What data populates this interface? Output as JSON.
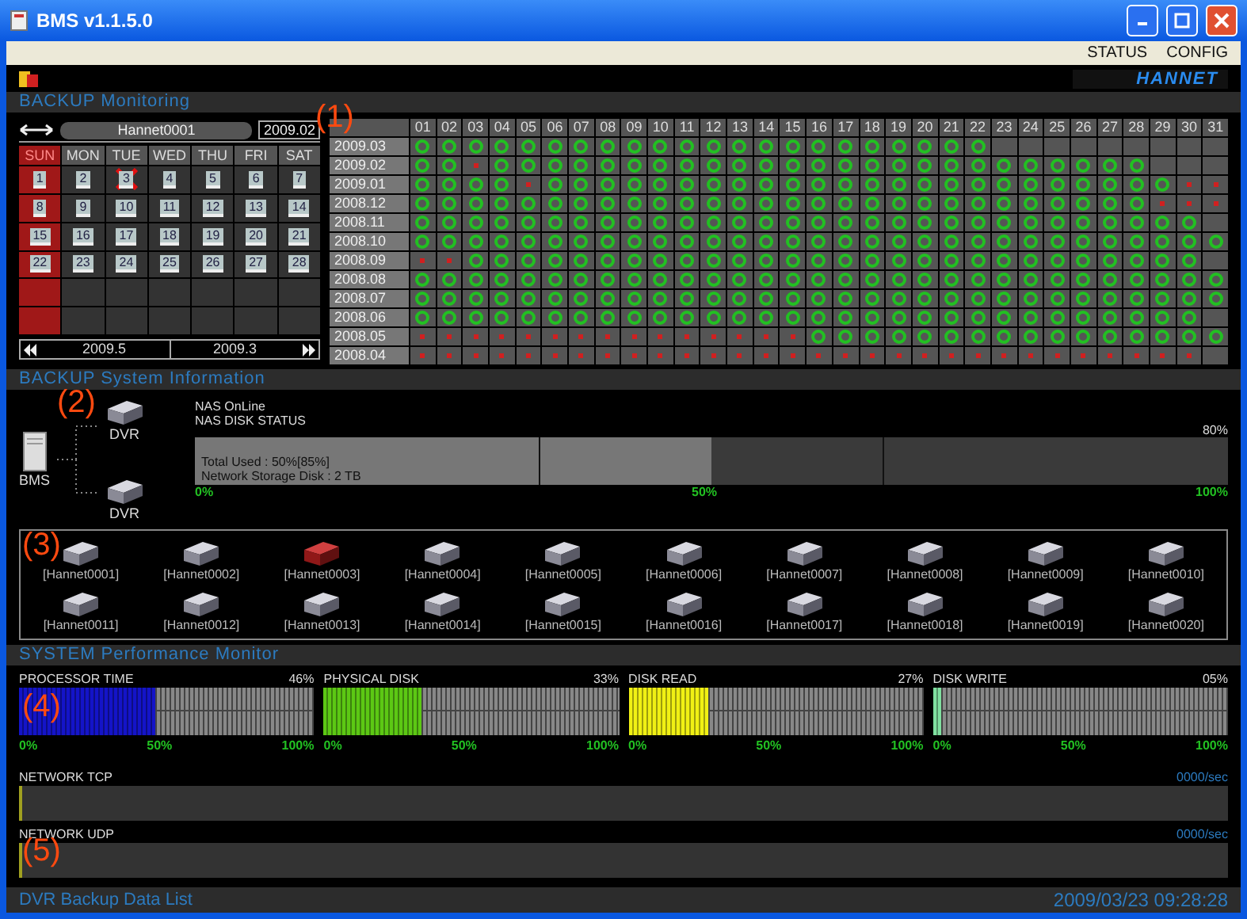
{
  "window": {
    "title": "BMS v1.1.5.0"
  },
  "menu": [
    "STATUS",
    "CONFIG"
  ],
  "logo": "HANNET",
  "callouts": [
    "(1)",
    "(2)",
    "(3)",
    "(4)",
    "(5)"
  ],
  "backup_monitoring": {
    "title": "BACKUP Monitoring",
    "calendar": {
      "device": "Hannet0001",
      "month": "2009.02",
      "weekdays": [
        "SUN",
        "MON",
        "TUE",
        "WED",
        "THU",
        "FRI",
        "SAT"
      ],
      "days": [
        {
          "label": "1",
          "failed": false
        },
        {
          "label": "2",
          "failed": false
        },
        {
          "label": "3",
          "failed": true
        },
        {
          "label": "4",
          "failed": false
        },
        {
          "label": "5",
          "failed": false
        },
        {
          "label": "6",
          "failed": false
        },
        {
          "label": "7",
          "failed": false
        },
        {
          "label": "8",
          "failed": false
        },
        {
          "label": "9",
          "failed": false
        },
        {
          "label": "10",
          "failed": false
        },
        {
          "label": "11",
          "failed": false
        },
        {
          "label": "12",
          "failed": false
        },
        {
          "label": "13",
          "failed": false
        },
        {
          "label": "14",
          "failed": false
        },
        {
          "label": "15",
          "failed": false
        },
        {
          "label": "16",
          "failed": false
        },
        {
          "label": "17",
          "failed": false
        },
        {
          "label": "18",
          "failed": false
        },
        {
          "label": "19",
          "failed": false
        },
        {
          "label": "20",
          "failed": false
        },
        {
          "label": "21",
          "failed": false
        },
        {
          "label": "22",
          "failed": false
        },
        {
          "label": "23",
          "failed": false
        },
        {
          "label": "24",
          "failed": false
        },
        {
          "label": "25",
          "failed": false
        },
        {
          "label": "26",
          "failed": false
        },
        {
          "label": "27",
          "failed": false
        },
        {
          "label": "28",
          "failed": false
        }
      ],
      "prev_month": "2009.5",
      "next_month": "2009.3"
    },
    "grid": {
      "columns": [
        "01",
        "02",
        "03",
        "04",
        "05",
        "06",
        "07",
        "08",
        "09",
        "10",
        "11",
        "12",
        "13",
        "14",
        "15",
        "16",
        "17",
        "18",
        "19",
        "20",
        "21",
        "22",
        "23",
        "24",
        "25",
        "26",
        "27",
        "28",
        "29",
        "30",
        "31"
      ],
      "rows": [
        {
          "month": "2009.03",
          "cells": [
            {
              "kind": "ok"
            },
            {
              "kind": "ok"
            },
            {
              "kind": "ok"
            },
            {
              "kind": "ok"
            },
            {
              "kind": "ok"
            },
            {
              "kind": "ok"
            },
            {
              "kind": "ok"
            },
            {
              "kind": "ok"
            },
            {
              "kind": "ok"
            },
            {
              "kind": "ok"
            },
            {
              "kind": "ok"
            },
            {
              "kind": "ok"
            },
            {
              "kind": "ok"
            },
            {
              "kind": "ok"
            },
            {
              "kind": "ok"
            },
            {
              "kind": "ok"
            },
            {
              "kind": "ok"
            },
            {
              "kind": "ok"
            },
            {
              "kind": "ok"
            },
            {
              "kind": "ok"
            },
            {
              "kind": "ok"
            },
            {
              "kind": "ok"
            },
            {
              "kind": "none"
            },
            {
              "kind": "none"
            },
            {
              "kind": "none"
            },
            {
              "kind": "none"
            },
            {
              "kind": "none"
            },
            {
              "kind": "none"
            },
            {
              "kind": "none"
            },
            {
              "kind": "none"
            },
            {
              "kind": "none"
            }
          ]
        },
        {
          "month": "2009.02",
          "cells": [
            {
              "kind": "ok"
            },
            {
              "kind": "ok"
            },
            {
              "kind": "fail"
            },
            {
              "kind": "ok"
            },
            {
              "kind": "ok"
            },
            {
              "kind": "ok"
            },
            {
              "kind": "ok"
            },
            {
              "kind": "ok"
            },
            {
              "kind": "ok"
            },
            {
              "kind": "ok"
            },
            {
              "kind": "ok"
            },
            {
              "kind": "ok"
            },
            {
              "kind": "ok"
            },
            {
              "kind": "ok"
            },
            {
              "kind": "ok"
            },
            {
              "kind": "ok"
            },
            {
              "kind": "ok"
            },
            {
              "kind": "ok"
            },
            {
              "kind": "ok"
            },
            {
              "kind": "ok"
            },
            {
              "kind": "ok"
            },
            {
              "kind": "ok"
            },
            {
              "kind": "ok"
            },
            {
              "kind": "ok"
            },
            {
              "kind": "ok"
            },
            {
              "kind": "ok"
            },
            {
              "kind": "ok"
            },
            {
              "kind": "ok"
            },
            {
              "kind": "none"
            },
            {
              "kind": "none"
            },
            {
              "kind": "none"
            }
          ]
        },
        {
          "month": "2009.01",
          "cells": [
            {
              "kind": "ok"
            },
            {
              "kind": "ok"
            },
            {
              "kind": "ok"
            },
            {
              "kind": "ok"
            },
            {
              "kind": "fail"
            },
            {
              "kind": "ok"
            },
            {
              "kind": "ok"
            },
            {
              "kind": "ok"
            },
            {
              "kind": "ok"
            },
            {
              "kind": "ok"
            },
            {
              "kind": "ok"
            },
            {
              "kind": "ok"
            },
            {
              "kind": "ok"
            },
            {
              "kind": "ok"
            },
            {
              "kind": "ok"
            },
            {
              "kind": "ok"
            },
            {
              "kind": "ok"
            },
            {
              "kind": "ok"
            },
            {
              "kind": "ok"
            },
            {
              "kind": "ok"
            },
            {
              "kind": "ok"
            },
            {
              "kind": "ok"
            },
            {
              "kind": "ok"
            },
            {
              "kind": "ok"
            },
            {
              "kind": "ok"
            },
            {
              "kind": "ok"
            },
            {
              "kind": "ok"
            },
            {
              "kind": "ok"
            },
            {
              "kind": "ok"
            },
            {
              "kind": "fail"
            },
            {
              "kind": "fail"
            }
          ]
        },
        {
          "month": "2008.12",
          "cells": [
            {
              "kind": "ok"
            },
            {
              "kind": "ok"
            },
            {
              "kind": "ok"
            },
            {
              "kind": "ok"
            },
            {
              "kind": "ok"
            },
            {
              "kind": "ok"
            },
            {
              "kind": "ok"
            },
            {
              "kind": "ok"
            },
            {
              "kind": "ok"
            },
            {
              "kind": "ok"
            },
            {
              "kind": "ok"
            },
            {
              "kind": "ok"
            },
            {
              "kind": "ok"
            },
            {
              "kind": "ok"
            },
            {
              "kind": "ok"
            },
            {
              "kind": "ok"
            },
            {
              "kind": "ok"
            },
            {
              "kind": "ok"
            },
            {
              "kind": "ok"
            },
            {
              "kind": "ok"
            },
            {
              "kind": "ok"
            },
            {
              "kind": "ok"
            },
            {
              "kind": "ok"
            },
            {
              "kind": "ok"
            },
            {
              "kind": "ok"
            },
            {
              "kind": "ok"
            },
            {
              "kind": "ok"
            },
            {
              "kind": "ok"
            },
            {
              "kind": "fail"
            },
            {
              "kind": "fail"
            },
            {
              "kind": "fail"
            }
          ]
        },
        {
          "month": "2008.11",
          "cells": [
            {
              "kind": "ok"
            },
            {
              "kind": "ok"
            },
            {
              "kind": "ok"
            },
            {
              "kind": "ok"
            },
            {
              "kind": "ok"
            },
            {
              "kind": "ok"
            },
            {
              "kind": "ok"
            },
            {
              "kind": "ok"
            },
            {
              "kind": "ok"
            },
            {
              "kind": "ok"
            },
            {
              "kind": "ok"
            },
            {
              "kind": "ok"
            },
            {
              "kind": "ok"
            },
            {
              "kind": "ok"
            },
            {
              "kind": "ok"
            },
            {
              "kind": "ok"
            },
            {
              "kind": "ok"
            },
            {
              "kind": "ok"
            },
            {
              "kind": "ok"
            },
            {
              "kind": "ok"
            },
            {
              "kind": "ok"
            },
            {
              "kind": "ok"
            },
            {
              "kind": "ok"
            },
            {
              "kind": "ok"
            },
            {
              "kind": "ok"
            },
            {
              "kind": "ok"
            },
            {
              "kind": "ok"
            },
            {
              "kind": "ok"
            },
            {
              "kind": "ok"
            },
            {
              "kind": "ok"
            },
            {
              "kind": "none"
            }
          ]
        },
        {
          "month": "2008.10",
          "cells": [
            {
              "kind": "ok"
            },
            {
              "kind": "ok"
            },
            {
              "kind": "ok"
            },
            {
              "kind": "ok"
            },
            {
              "kind": "ok"
            },
            {
              "kind": "ok"
            },
            {
              "kind": "ok"
            },
            {
              "kind": "ok"
            },
            {
              "kind": "ok"
            },
            {
              "kind": "ok"
            },
            {
              "kind": "ok"
            },
            {
              "kind": "ok"
            },
            {
              "kind": "ok"
            },
            {
              "kind": "ok"
            },
            {
              "kind": "ok"
            },
            {
              "kind": "ok"
            },
            {
              "kind": "ok"
            },
            {
              "kind": "ok"
            },
            {
              "kind": "ok"
            },
            {
              "kind": "ok"
            },
            {
              "kind": "ok"
            },
            {
              "kind": "ok"
            },
            {
              "kind": "ok"
            },
            {
              "kind": "ok"
            },
            {
              "kind": "ok"
            },
            {
              "kind": "ok"
            },
            {
              "kind": "ok"
            },
            {
              "kind": "ok"
            },
            {
              "kind": "ok"
            },
            {
              "kind": "ok"
            },
            {
              "kind": "ok"
            }
          ]
        },
        {
          "month": "2008.09",
          "cells": [
            {
              "kind": "fail"
            },
            {
              "kind": "fail"
            },
            {
              "kind": "ok"
            },
            {
              "kind": "ok"
            },
            {
              "kind": "ok"
            },
            {
              "kind": "ok"
            },
            {
              "kind": "ok"
            },
            {
              "kind": "ok"
            },
            {
              "kind": "ok"
            },
            {
              "kind": "ok"
            },
            {
              "kind": "ok"
            },
            {
              "kind": "ok"
            },
            {
              "kind": "ok"
            },
            {
              "kind": "ok"
            },
            {
              "kind": "ok"
            },
            {
              "kind": "ok"
            },
            {
              "kind": "ok"
            },
            {
              "kind": "ok"
            },
            {
              "kind": "ok"
            },
            {
              "kind": "ok"
            },
            {
              "kind": "ok"
            },
            {
              "kind": "ok"
            },
            {
              "kind": "ok"
            },
            {
              "kind": "ok"
            },
            {
              "kind": "ok"
            },
            {
              "kind": "ok"
            },
            {
              "kind": "ok"
            },
            {
              "kind": "ok"
            },
            {
              "kind": "ok"
            },
            {
              "kind": "ok"
            },
            {
              "kind": "none"
            }
          ]
        },
        {
          "month": "2008.08",
          "cells": [
            {
              "kind": "ok"
            },
            {
              "kind": "ok"
            },
            {
              "kind": "ok"
            },
            {
              "kind": "ok"
            },
            {
              "kind": "ok"
            },
            {
              "kind": "ok"
            },
            {
              "kind": "ok"
            },
            {
              "kind": "ok"
            },
            {
              "kind": "ok"
            },
            {
              "kind": "ok"
            },
            {
              "kind": "ok"
            },
            {
              "kind": "ok"
            },
            {
              "kind": "ok"
            },
            {
              "kind": "ok"
            },
            {
              "kind": "ok"
            },
            {
              "kind": "ok"
            },
            {
              "kind": "ok"
            },
            {
              "kind": "ok"
            },
            {
              "kind": "ok"
            },
            {
              "kind": "ok"
            },
            {
              "kind": "ok"
            },
            {
              "kind": "ok"
            },
            {
              "kind": "ok"
            },
            {
              "kind": "ok"
            },
            {
              "kind": "ok"
            },
            {
              "kind": "ok"
            },
            {
              "kind": "ok"
            },
            {
              "kind": "ok"
            },
            {
              "kind": "ok"
            },
            {
              "kind": "ok"
            },
            {
              "kind": "ok"
            }
          ]
        },
        {
          "month": "2008.07",
          "cells": [
            {
              "kind": "ok"
            },
            {
              "kind": "ok"
            },
            {
              "kind": "ok"
            },
            {
              "kind": "ok"
            },
            {
              "kind": "ok"
            },
            {
              "kind": "ok"
            },
            {
              "kind": "ok"
            },
            {
              "kind": "ok"
            },
            {
              "kind": "ok"
            },
            {
              "kind": "ok"
            },
            {
              "kind": "ok"
            },
            {
              "kind": "ok"
            },
            {
              "kind": "ok"
            },
            {
              "kind": "ok"
            },
            {
              "kind": "ok"
            },
            {
              "kind": "ok"
            },
            {
              "kind": "ok"
            },
            {
              "kind": "ok"
            },
            {
              "kind": "ok"
            },
            {
              "kind": "ok"
            },
            {
              "kind": "ok"
            },
            {
              "kind": "ok"
            },
            {
              "kind": "ok"
            },
            {
              "kind": "ok"
            },
            {
              "kind": "ok"
            },
            {
              "kind": "ok"
            },
            {
              "kind": "ok"
            },
            {
              "kind": "ok"
            },
            {
              "kind": "ok"
            },
            {
              "kind": "ok"
            },
            {
              "kind": "ok"
            }
          ]
        },
        {
          "month": "2008.06",
          "cells": [
            {
              "kind": "ok"
            },
            {
              "kind": "ok"
            },
            {
              "kind": "ok"
            },
            {
              "kind": "ok"
            },
            {
              "kind": "ok"
            },
            {
              "kind": "ok"
            },
            {
              "kind": "ok"
            },
            {
              "kind": "ok"
            },
            {
              "kind": "ok"
            },
            {
              "kind": "ok"
            },
            {
              "kind": "ok"
            },
            {
              "kind": "ok"
            },
            {
              "kind": "ok"
            },
            {
              "kind": "ok"
            },
            {
              "kind": "ok"
            },
            {
              "kind": "ok"
            },
            {
              "kind": "ok"
            },
            {
              "kind": "ok"
            },
            {
              "kind": "ok"
            },
            {
              "kind": "ok"
            },
            {
              "kind": "ok"
            },
            {
              "kind": "ok"
            },
            {
              "kind": "ok"
            },
            {
              "kind": "ok"
            },
            {
              "kind": "ok"
            },
            {
              "kind": "ok"
            },
            {
              "kind": "ok"
            },
            {
              "kind": "ok"
            },
            {
              "kind": "ok"
            },
            {
              "kind": "ok"
            },
            {
              "kind": "none"
            }
          ]
        },
        {
          "month": "2008.05",
          "cells": [
            {
              "kind": "fail"
            },
            {
              "kind": "fail"
            },
            {
              "kind": "fail"
            },
            {
              "kind": "fail"
            },
            {
              "kind": "fail"
            },
            {
              "kind": "fail"
            },
            {
              "kind": "fail"
            },
            {
              "kind": "fail"
            },
            {
              "kind": "fail"
            },
            {
              "kind": "fail"
            },
            {
              "kind": "fail"
            },
            {
              "kind": "fail"
            },
            {
              "kind": "fail"
            },
            {
              "kind": "fail"
            },
            {
              "kind": "fail"
            },
            {
              "kind": "ok"
            },
            {
              "kind": "ok"
            },
            {
              "kind": "ok"
            },
            {
              "kind": "ok"
            },
            {
              "kind": "ok"
            },
            {
              "kind": "ok"
            },
            {
              "kind": "ok"
            },
            {
              "kind": "ok"
            },
            {
              "kind": "ok"
            },
            {
              "kind": "ok"
            },
            {
              "kind": "ok"
            },
            {
              "kind": "ok"
            },
            {
              "kind": "ok"
            },
            {
              "kind": "ok"
            },
            {
              "kind": "ok"
            },
            {
              "kind": "ok"
            }
          ]
        },
        {
          "month": "2008.04",
          "cells": [
            {
              "kind": "fail"
            },
            {
              "kind": "fail"
            },
            {
              "kind": "fail"
            },
            {
              "kind": "fail"
            },
            {
              "kind": "fail"
            },
            {
              "kind": "fail"
            },
            {
              "kind": "fail"
            },
            {
              "kind": "fail"
            },
            {
              "kind": "fail"
            },
            {
              "kind": "fail"
            },
            {
              "kind": "fail"
            },
            {
              "kind": "fail"
            },
            {
              "kind": "fail"
            },
            {
              "kind": "fail"
            },
            {
              "kind": "fail"
            },
            {
              "kind": "fail"
            },
            {
              "kind": "fail"
            },
            {
              "kind": "fail"
            },
            {
              "kind": "fail"
            },
            {
              "kind": "fail"
            },
            {
              "kind": "fail"
            },
            {
              "kind": "fail"
            },
            {
              "kind": "fail"
            },
            {
              "kind": "fail"
            },
            {
              "kind": "fail"
            },
            {
              "kind": "fail"
            },
            {
              "kind": "fail"
            },
            {
              "kind": "fail"
            },
            {
              "kind": "fail"
            },
            {
              "kind": "fail"
            },
            {
              "kind": "none"
            }
          ]
        }
      ]
    }
  },
  "system_info": {
    "title": "BACKUP System Information",
    "server_label": "BMS",
    "dvr_labels": [
      "DVR",
      "DVR"
    ],
    "nas_state": "NAS OnLine",
    "disk_title": "NAS DISK STATUS",
    "disk": {
      "reading": "80%",
      "level": 0.5,
      "total_used": "Total Used : 50%[85%]",
      "storage": "Network Storage Disk : 2 TB",
      "ticks": [
        "0%",
        "50%",
        "100%"
      ]
    }
  },
  "dvrs": [
    {
      "label": "[Hannet0001]",
      "error": false
    },
    {
      "label": "[Hannet0002]",
      "error": false
    },
    {
      "label": "[Hannet0003]",
      "error": true
    },
    {
      "label": "[Hannet0004]",
      "error": false
    },
    {
      "label": "[Hannet0005]",
      "error": false
    },
    {
      "label": "[Hannet0006]",
      "error": false
    },
    {
      "label": "[Hannet0007]",
      "error": false
    },
    {
      "label": "[Hannet0008]",
      "error": false
    },
    {
      "label": "[Hannet0009]",
      "error": false
    },
    {
      "label": "[Hannet0010]",
      "error": false
    },
    {
      "label": "[Hannet0011]",
      "error": false
    },
    {
      "label": "[Hannet0012]",
      "error": false
    },
    {
      "label": "[Hannet0013]",
      "error": false
    },
    {
      "label": "[Hannet0014]",
      "error": false
    },
    {
      "label": "[Hannet0015]",
      "error": false
    },
    {
      "label": "[Hannet0016]",
      "error": false
    },
    {
      "label": "[Hannet0017]",
      "error": false
    },
    {
      "label": "[Hannet0018]",
      "error": false
    },
    {
      "label": "[Hannet0019]",
      "error": false
    },
    {
      "label": "[Hannet0020]",
      "error": false
    }
  ],
  "performance": {
    "title": "SYSTEM Performance Monitor",
    "meters": [
      {
        "name": "PROCESSOR TIME",
        "reading": "46%",
        "level": 0.46,
        "color": "#1414c8",
        "ticks": [
          "0%",
          "50%",
          "100%"
        ]
      },
      {
        "name": "PHYSICAL DISK",
        "reading": "33%",
        "level": 0.33,
        "color": "#5cc814",
        "ticks": [
          "0%",
          "50%",
          "100%"
        ]
      },
      {
        "name": "DISK READ",
        "reading": "27%",
        "level": 0.27,
        "color": "#f0f014",
        "ticks": [
          "0%",
          "50%",
          "100%"
        ]
      },
      {
        "name": "DISK WRITE",
        "reading": "05%",
        "level": 0.03,
        "color": "#80e0a0",
        "ticks": [
          "0%",
          "50%",
          "100%"
        ]
      }
    ],
    "network": [
      {
        "name": "NETWORK TCP",
        "rate": "0000/sec"
      },
      {
        "name": "NETWORK UDP",
        "rate": "0000/sec"
      }
    ]
  },
  "footer": {
    "title": "DVR Backup Data List",
    "timestamp": "2009/03/23 09:28:28"
  }
}
